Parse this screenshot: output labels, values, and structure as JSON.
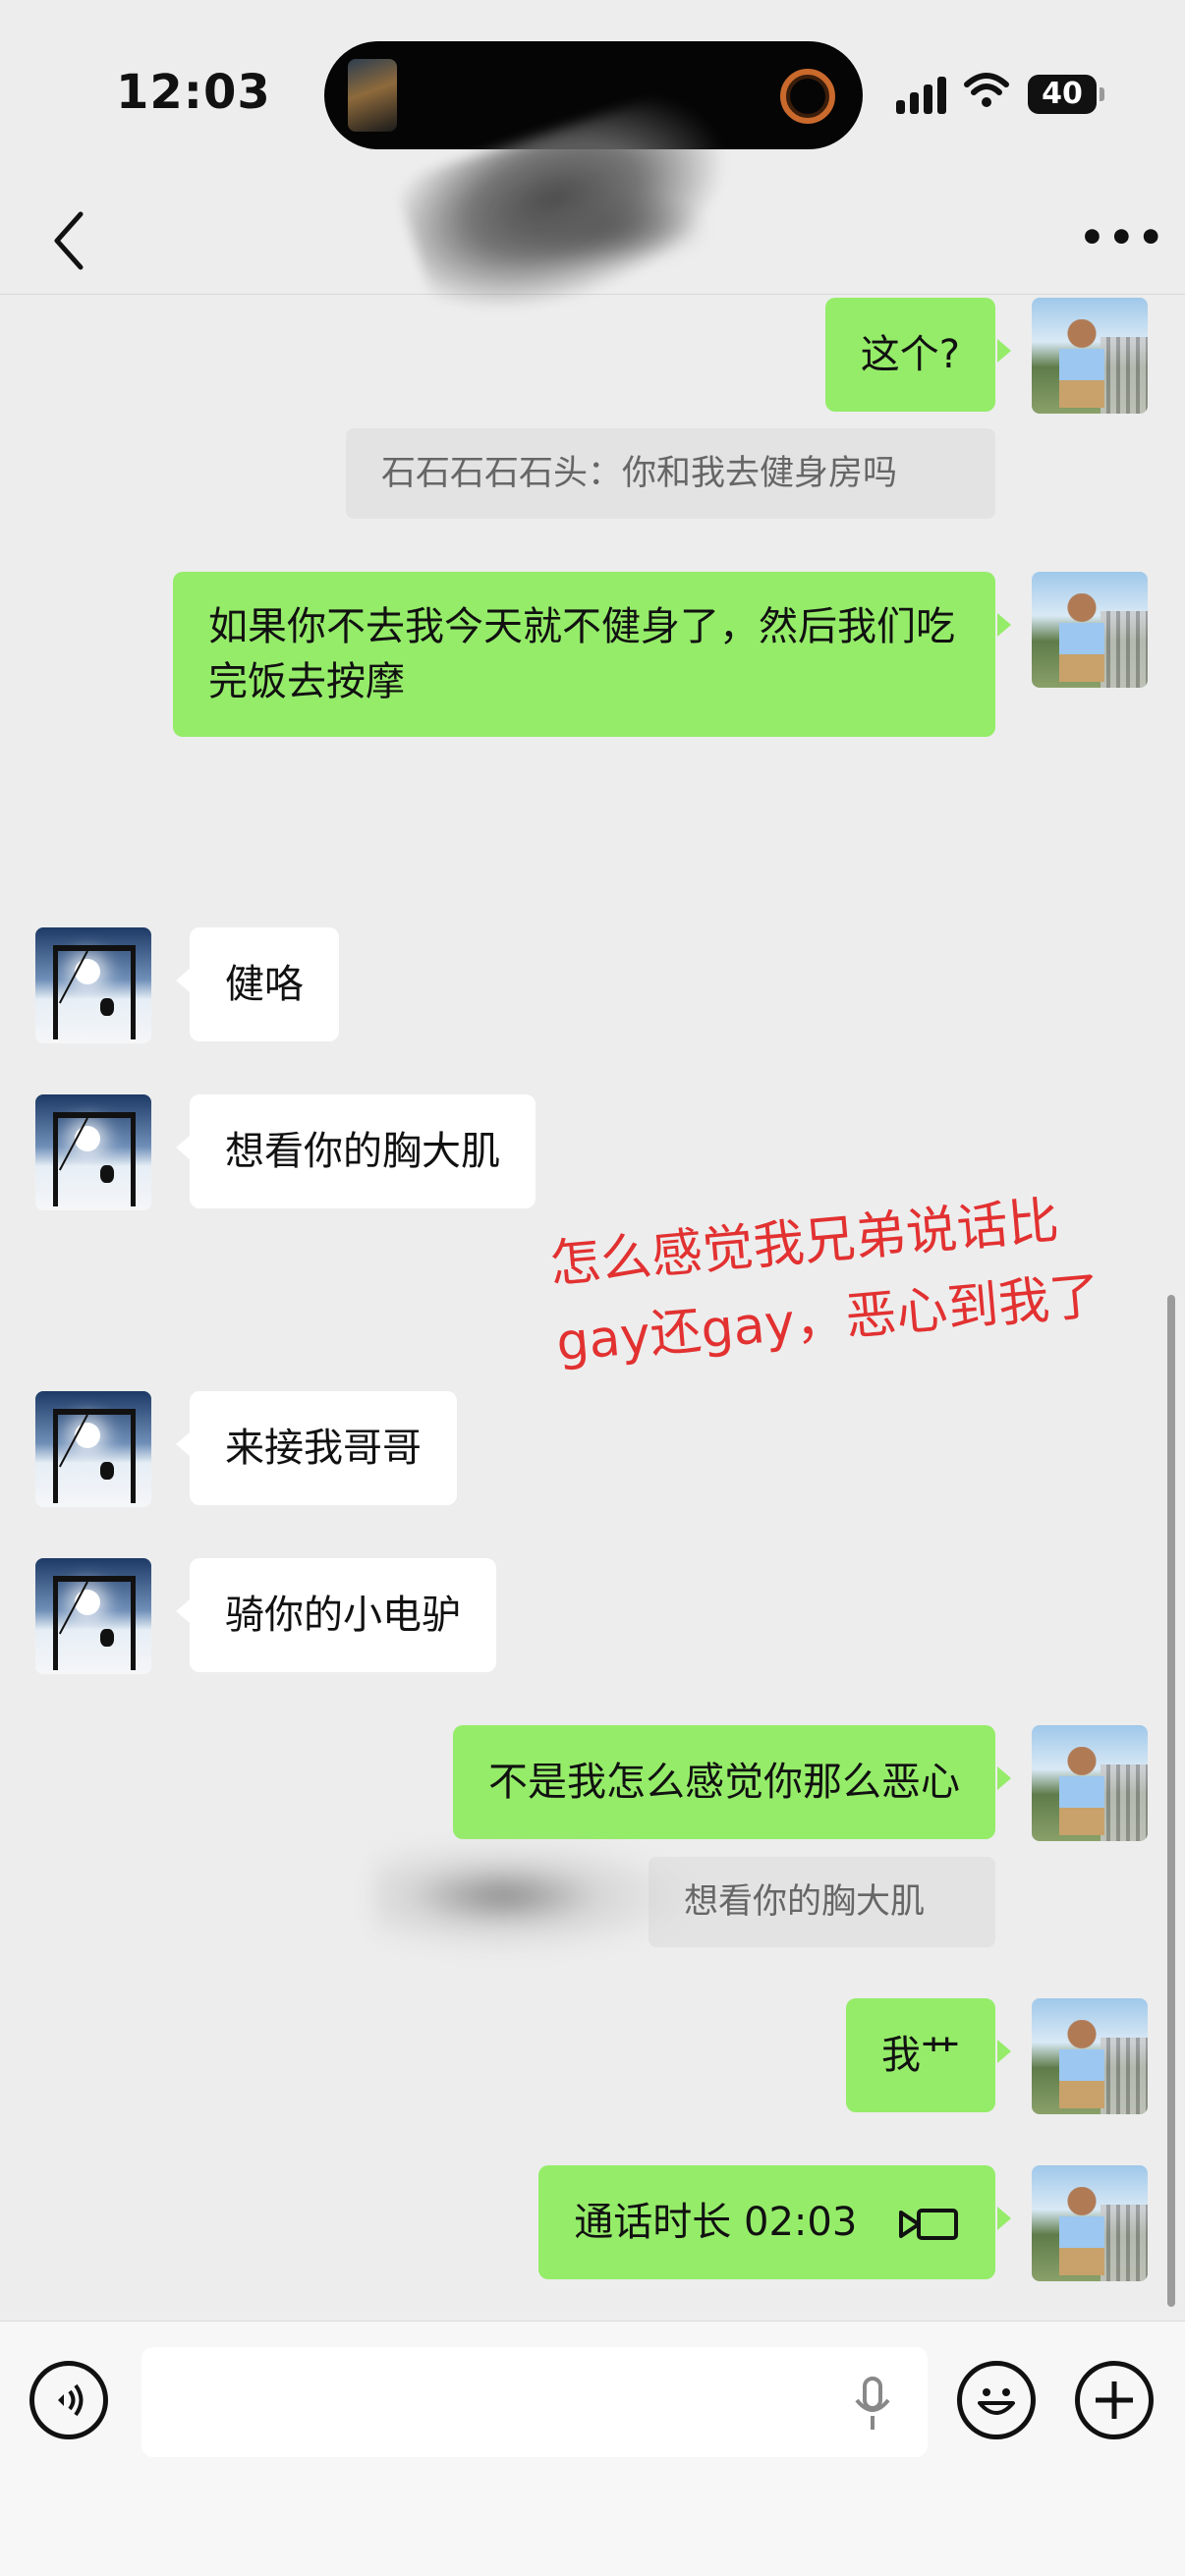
{
  "status": {
    "time": "12:03",
    "battery": "40"
  },
  "messages": [
    {
      "side": "me",
      "text": "这个?"
    },
    {
      "type": "quote",
      "text": "石石石石石头：你和我去健身房吗"
    },
    {
      "side": "me",
      "text": "如果你不去我今天就不健身了，然后我们吃完饭去按摩"
    },
    {
      "side": "them",
      "text": "健咯"
    },
    {
      "side": "them",
      "text": "想看你的胸大肌"
    },
    {
      "side": "them",
      "text": "来接我哥哥"
    },
    {
      "side": "them",
      "text": "骑你的小电驴"
    },
    {
      "side": "me",
      "text": "不是我怎么感觉你那么恶心"
    },
    {
      "type": "quote",
      "text": "想看你的胸大肌"
    },
    {
      "side": "me",
      "text": "我艹"
    },
    {
      "side": "me",
      "type": "call",
      "text": "通话时长 02:03"
    }
  ],
  "annotation": "怎么感觉我兄弟说话比gay还gay，恶心到我了",
  "icons": {
    "back": "chevron-left-icon",
    "more": "more-dots-icon",
    "voice": "voice-icon",
    "mic": "mic-icon",
    "emoji": "emoji-icon",
    "plus": "plus-icon",
    "call": "video-call-icon"
  },
  "colors": {
    "my_bubble": "#95ec69",
    "their_bubble": "#ffffff",
    "background": "#ededed",
    "annotation": "#e23131"
  }
}
